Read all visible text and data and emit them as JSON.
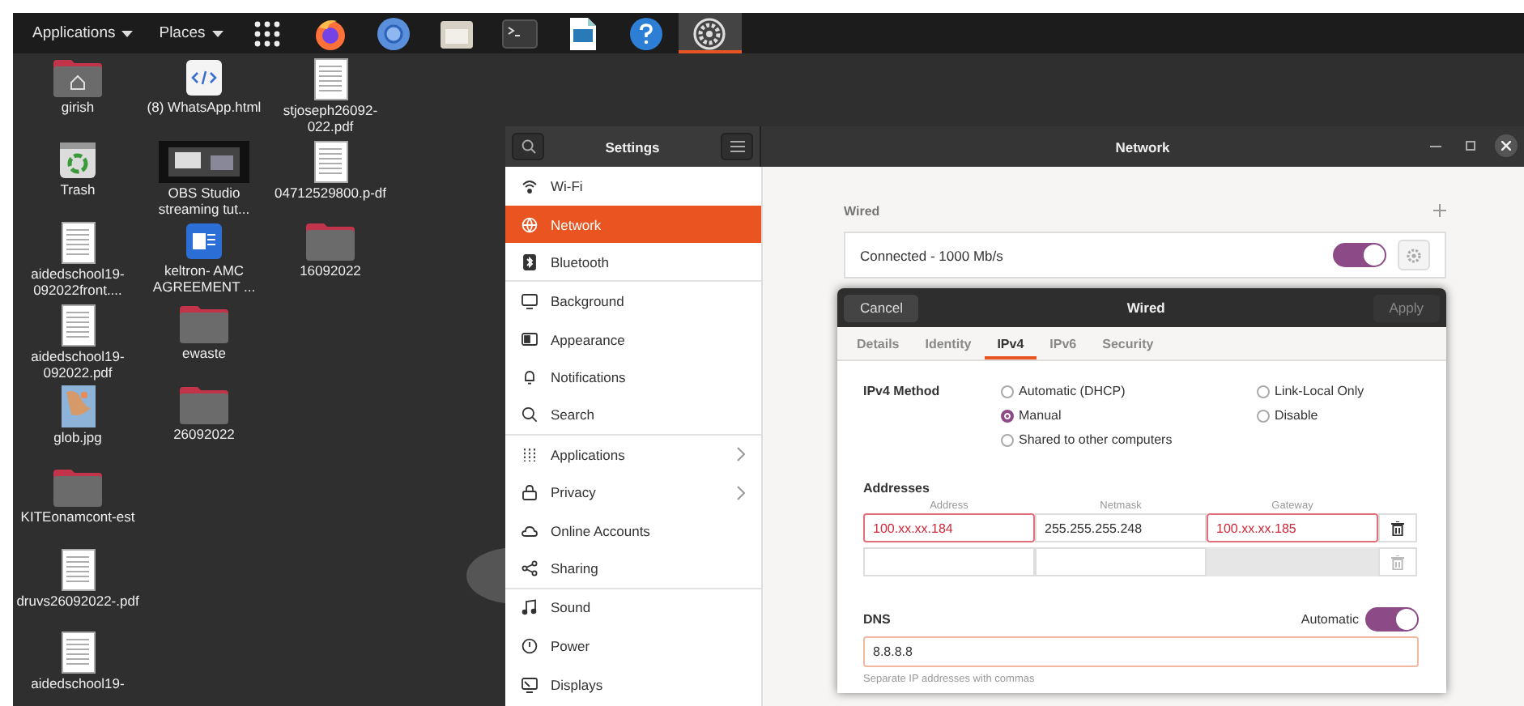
{
  "top_panel": {
    "menus": [
      {
        "label": "Applications"
      },
      {
        "label": "Places"
      }
    ],
    "launchers": [
      {
        "kind": "grid",
        "selected": false
      },
      {
        "kind": "firefox",
        "selected": false
      },
      {
        "kind": "chromium",
        "selected": false
      },
      {
        "kind": "files",
        "selected": false
      },
      {
        "kind": "terminal",
        "selected": false
      },
      {
        "kind": "writer",
        "selected": false
      },
      {
        "kind": "help",
        "selected": false
      },
      {
        "kind": "settings",
        "selected": true
      }
    ]
  },
  "desktop": {
    "columns": [
      [
        {
          "label": "girish",
          "kind": "home"
        },
        {
          "label": "Trash",
          "kind": "trash"
        },
        {
          "label": "aidedschool19-092022front....",
          "kind": "pdf"
        },
        {
          "label": "aidedschool19-092022.pdf",
          "kind": "pdf"
        },
        {
          "label": "glob.jpg",
          "kind": "image"
        },
        {
          "label": "KITEonamcont-est",
          "kind": "folder"
        },
        {
          "label": "druvs26092022-.pdf",
          "kind": "pdf"
        },
        {
          "label": "aidedschool19-",
          "kind": "pdf"
        }
      ],
      [
        {
          "label": "(8) WhatsApp.html",
          "kind": "html"
        },
        {
          "label": "OBS Studio streaming tut...",
          "kind": "video"
        },
        {
          "label": "keltron- AMC AGREEMENT ...",
          "kind": "word"
        },
        {
          "label": "ewaste",
          "kind": "folder"
        },
        {
          "label": "26092022",
          "kind": "folder"
        }
      ],
      [
        {
          "label": "stjoseph26092-022.pdf",
          "kind": "pdf"
        },
        {
          "label": "04712529800.p-df",
          "kind": "pdf"
        },
        {
          "label": "16092022",
          "kind": "folder"
        }
      ]
    ]
  },
  "settings": {
    "sidebar_title": "Settings",
    "title": "Network",
    "sidebar": {
      "items": [
        {
          "label": "Wi-Fi",
          "kind": "wifi",
          "selected": false,
          "submenu": false,
          "divider_after": false
        },
        {
          "label": "Network",
          "kind": "network",
          "selected": true,
          "submenu": false,
          "divider_after": false
        },
        {
          "label": "Bluetooth",
          "kind": "bluetooth",
          "selected": false,
          "submenu": false,
          "divider_after": true
        },
        {
          "label": "Background",
          "kind": "background",
          "selected": false,
          "submenu": false,
          "divider_after": false
        },
        {
          "label": "Appearance",
          "kind": "appearance",
          "selected": false,
          "submenu": false,
          "divider_after": false
        },
        {
          "label": "Notifications",
          "kind": "notifications",
          "selected": false,
          "submenu": false,
          "divider_after": false
        },
        {
          "label": "Search",
          "kind": "search",
          "selected": false,
          "submenu": false,
          "divider_after": true
        },
        {
          "label": "Applications",
          "kind": "applications",
          "selected": false,
          "submenu": true,
          "divider_after": false
        },
        {
          "label": "Privacy",
          "kind": "privacy",
          "selected": false,
          "submenu": true,
          "divider_after": false
        },
        {
          "label": "Online Accounts",
          "kind": "cloud",
          "selected": false,
          "submenu": false,
          "divider_after": false
        },
        {
          "label": "Sharing",
          "kind": "sharing",
          "selected": false,
          "submenu": false,
          "divider_after": true
        },
        {
          "label": "Sound",
          "kind": "sound",
          "selected": false,
          "submenu": false,
          "divider_after": false
        },
        {
          "label": "Power",
          "kind": "power",
          "selected": false,
          "submenu": false,
          "divider_after": false
        },
        {
          "label": "Displays",
          "kind": "displays",
          "selected": false,
          "submenu": false,
          "divider_after": false
        }
      ]
    },
    "wired": {
      "heading": "Wired",
      "connection": {
        "status": "Connected - 1000 Mb/s",
        "on": true
      }
    }
  },
  "dialog": {
    "title": "Wired",
    "cancel": "Cancel",
    "apply": {
      "label": "Apply",
      "disabled": true
    },
    "tabs": [
      {
        "label": "Details",
        "selected": false
      },
      {
        "label": "Identity",
        "selected": false
      },
      {
        "label": "IPv4",
        "selected": true
      },
      {
        "label": "IPv6",
        "selected": false
      },
      {
        "label": "Security",
        "selected": false
      }
    ],
    "method_label": "IPv4 Method",
    "methods": [
      [
        {
          "label": "Automatic (DHCP)",
          "selected": false
        },
        {
          "label": "Manual",
          "selected": true
        },
        {
          "label": "Shared to other computers",
          "selected": false
        }
      ],
      [
        {
          "label": "Link-Local Only",
          "selected": false
        },
        {
          "label": "Disable",
          "selected": false
        }
      ]
    ],
    "addresses": {
      "heading": "Addresses",
      "columns": [
        "Address",
        "Netmask",
        "Gateway"
      ],
      "rows": [
        {
          "cells": [
            {
              "value": "100.xx.xx.184",
              "invalid": true,
              "disabled": false
            },
            {
              "value": "255.255.255.248",
              "invalid": false,
              "disabled": false
            },
            {
              "value": "100.xx.xx.185",
              "invalid": true,
              "disabled": false
            }
          ],
          "delete_disabled": false
        },
        {
          "cells": [
            {
              "invalid": false,
              "disabled": false
            },
            {
              "invalid": false,
              "disabled": false
            },
            {
              "invalid": false,
              "disabled": true
            }
          ],
          "delete_disabled": true
        }
      ]
    },
    "dns": {
      "heading": "DNS",
      "automatic_label": "Automatic",
      "automatic": true,
      "value": "8.8.8.8",
      "hint": "Separate IP addresses with commas"
    }
  }
}
